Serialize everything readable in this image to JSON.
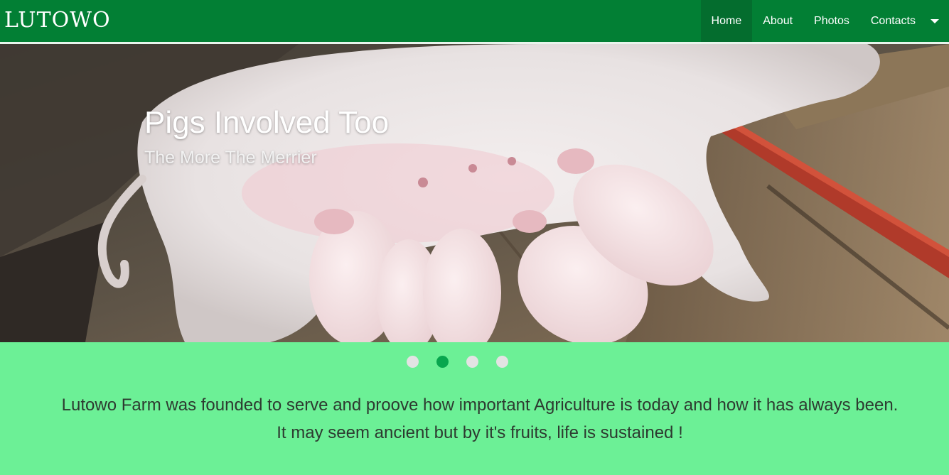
{
  "header": {
    "brand": "LUTOWO",
    "nav": [
      {
        "label": "Home",
        "active": true
      },
      {
        "label": "About",
        "active": false
      },
      {
        "label": "Photos",
        "active": false
      },
      {
        "label": "Contacts",
        "active": false
      }
    ],
    "colors": {
      "bar": "#027f34",
      "active": "#046d2e"
    }
  },
  "carousel": {
    "slide": {
      "title": "Pigs Involved Too",
      "subtitle": "The More The Merrier",
      "image": "sow-nursing-piglets-photo"
    },
    "indicators": [
      {
        "active": false
      },
      {
        "active": true
      },
      {
        "active": false
      },
      {
        "active": false
      }
    ],
    "colors": {
      "indicator": "#e3e3e3",
      "indicator_active": "#08a64e"
    }
  },
  "intro": {
    "line1": "Lutowo Farm was founded to serve and proove how important Agriculture is today and how it has always been.",
    "line2": "It may seem ancient but by it's fruits, life is sustained !"
  },
  "theme": {
    "background": "#6cf096"
  }
}
